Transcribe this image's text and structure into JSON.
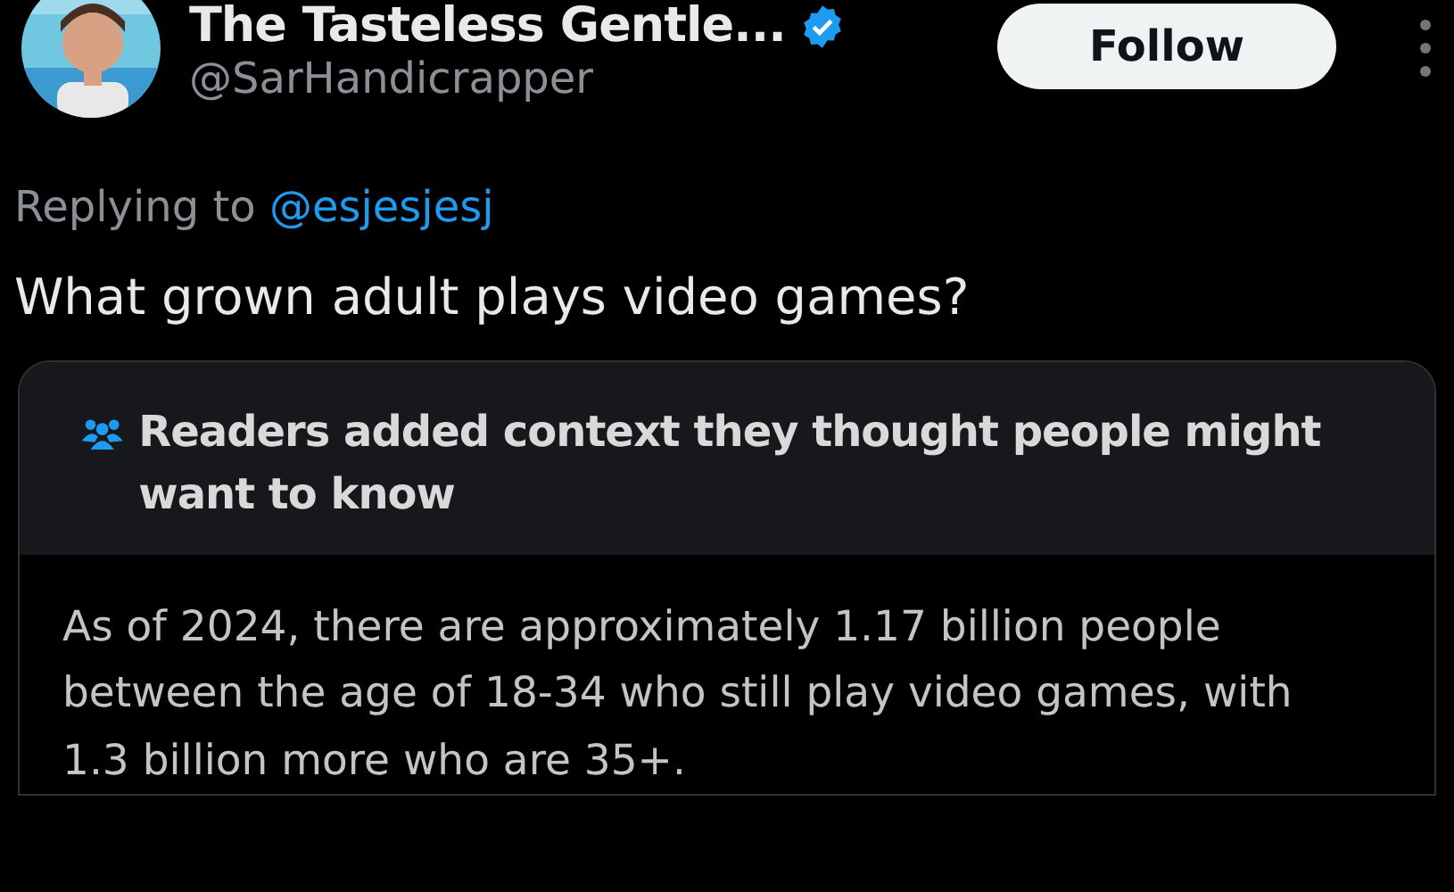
{
  "author": {
    "name": "The Tasteless Gentle...",
    "verified": true,
    "handle": "@SarHandicrapper"
  },
  "follow_button": {
    "label": "Follow"
  },
  "reply": {
    "prefix": "Replying to",
    "mention": "@esjesjesj"
  },
  "tweet_text": "What grown adult plays video games?",
  "community_note": {
    "title": "Readers added context they thought people might want to know",
    "body": "As of 2024, there are approximately 1.17 billion people between the age of 18-34 who still play video games, with 1.3 billion more who are 35+."
  }
}
